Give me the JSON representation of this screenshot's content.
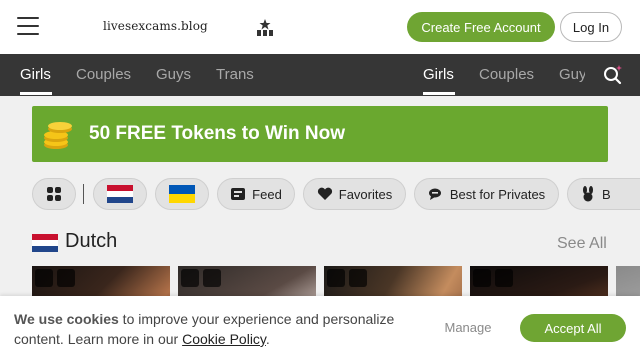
{
  "header": {
    "brand": "livesexcams.blog",
    "create_account_label": "Create Free Account",
    "login_label": "Log In"
  },
  "nav": {
    "left_items": [
      "Girls",
      "Couples",
      "Guys",
      "Trans"
    ],
    "right_items": [
      "Girls",
      "Couples",
      "Guy"
    ],
    "active": "Girls"
  },
  "promo": {
    "text": "50 FREE Tokens to Win Now"
  },
  "filters": {
    "feed": "Feed",
    "favorites": "Favorites",
    "best_for_privates": "Best for Privates",
    "partial": "B"
  },
  "section": {
    "title": "Dutch",
    "see_all": "See All"
  },
  "cookie": {
    "bold": "We use cookies",
    "text_1": " to improve your experience and personalize content. Learn more in our ",
    "link": "Cookie Policy",
    "text_2": ".",
    "manage": "Manage",
    "accept": "Accept All"
  },
  "colors": {
    "accent_green": "#6fa533",
    "navbar": "#363636"
  },
  "icons": [
    "hamburger-icon",
    "star-grid-icon",
    "search-icon",
    "coins-icon",
    "grid-icon",
    "netherlands-flag-icon",
    "ukraine-flag-icon",
    "feed-icon",
    "heart-icon",
    "chat-icon",
    "bunny-icon",
    "mobile-icon",
    "vr-icon"
  ]
}
